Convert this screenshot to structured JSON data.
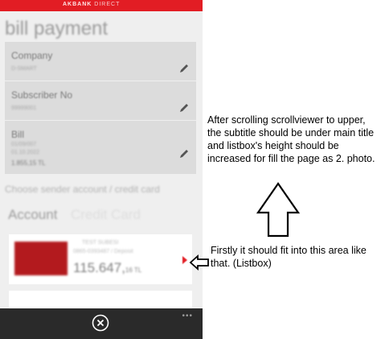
{
  "app": {
    "brand": "AKBANK",
    "brand_sub": "DIRECT",
    "title": "bill payment"
  },
  "form": {
    "company": {
      "label": "Company",
      "value": "D-SMART"
    },
    "subscriber": {
      "label": "Subscriber No",
      "value": "99999001"
    },
    "bill": {
      "label": "Bill",
      "line1": "01/09/007",
      "line2": "01.10.2022",
      "amount": "1.855,15 TL"
    }
  },
  "choose_label": "Choose sender account / credit card",
  "tabs": [
    "Account",
    "Credit Card"
  ],
  "account_card": {
    "holder": "TEST SUBESI",
    "number": "0865-0393487 / Deposit",
    "amount_main": "115.647,",
    "amount_dec": "16 TL"
  },
  "app_bar": {
    "more": "•••"
  },
  "annotations": {
    "note1": "After scrolling scrollviewer to upper, the subtitle should be under main title and listbox's height should be increased for fill the page as 2. photo.",
    "note2": "Firstly it should fit into this area like that. (Listbox)"
  },
  "colors": {
    "accent": "#e21d24",
    "appbar": "#2a2a2a",
    "background": "#efefef"
  }
}
